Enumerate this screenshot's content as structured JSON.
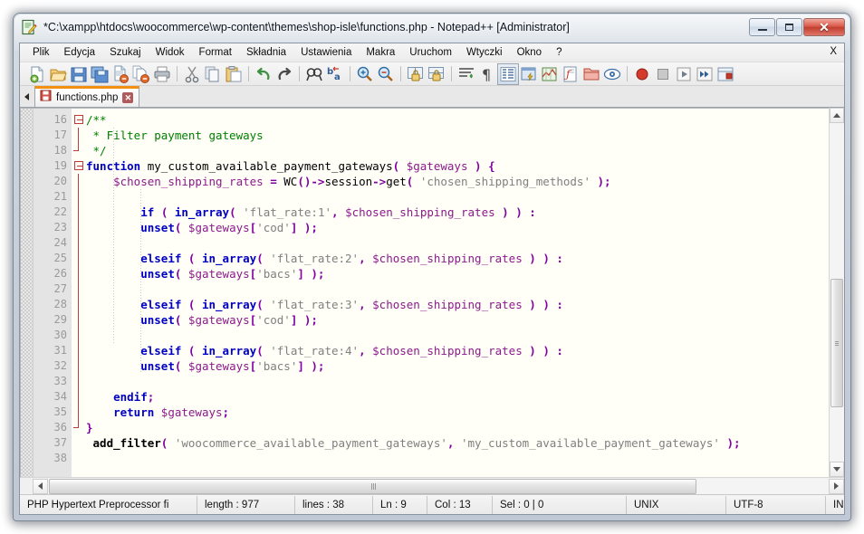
{
  "window": {
    "title": "*C:\\xampp\\htdocs\\woocommerce\\wp-content\\themes\\shop-isle\\functions.php - Notepad++ [Administrator]",
    "minimize_label": "",
    "maximize_label": "",
    "close_label": "✕"
  },
  "menu": {
    "items": [
      {
        "label": "Plik"
      },
      {
        "label": "Edycja"
      },
      {
        "label": "Szukaj"
      },
      {
        "label": "Widok"
      },
      {
        "label": "Format"
      },
      {
        "label": "Składnia"
      },
      {
        "label": "Ustawienia"
      },
      {
        "label": "Makra"
      },
      {
        "label": "Uruchom"
      },
      {
        "label": "Wtyczki"
      },
      {
        "label": "Okno"
      },
      {
        "label": "?"
      }
    ],
    "right_label": "X"
  },
  "toolbar": {
    "icons": [
      "new-file-icon",
      "open-file-icon",
      "save-icon",
      "save-all-icon",
      "close-file-icon",
      "close-all-icon",
      "print-icon",
      "cut-icon",
      "copy-icon",
      "paste-icon",
      "undo-icon",
      "redo-icon",
      "find-icon",
      "replace-icon",
      "zoom-in-icon",
      "zoom-out-icon",
      "sync-vertical-icon",
      "sync-horizontal-icon",
      "word-wrap-icon",
      "show-all-chars-icon",
      "indent-guide-icon",
      "user-defined-dialog-icon",
      "show-doc-map-icon",
      "function-list-icon",
      "folder-as-workspace-icon",
      "monitoring-icon",
      "record-macro-icon",
      "stop-macro-icon",
      "play-macro-icon",
      "run-macro-multiple-icon",
      "save-macro-icon"
    ]
  },
  "tabs": {
    "scroll_left_icon": "chevron-left-icon",
    "items": [
      {
        "label": "functions.php",
        "icon": "save-red-icon",
        "close_label": "✕",
        "active": true
      }
    ]
  },
  "editor": {
    "first_line": 16,
    "lines": [
      {
        "n": 16,
        "fold": "open",
        "tokens": [
          {
            "t": "/**",
            "c": "cmt"
          }
        ]
      },
      {
        "n": 17,
        "fold": "bar",
        "tokens": [
          {
            "t": " * Filter payment gateways",
            "c": "cmt"
          }
        ]
      },
      {
        "n": 18,
        "fold": "end",
        "tokens": [
          {
            "t": " */",
            "c": "cmt"
          }
        ]
      },
      {
        "n": 19,
        "fold": "open",
        "tokens": [
          {
            "t": "function",
            "c": "kw"
          },
          {
            "t": " my_custom_available_payment_gateways",
            "c": "pl"
          },
          {
            "t": "(",
            "c": "op"
          },
          {
            "t": " ",
            "c": "pl"
          },
          {
            "t": "$gateways",
            "c": "var"
          },
          {
            "t": " ",
            "c": "pl"
          },
          {
            "t": ")",
            "c": "op"
          },
          {
            "t": " ",
            "c": "pl"
          },
          {
            "t": "{",
            "c": "op"
          }
        ]
      },
      {
        "n": 20,
        "fold": "bar",
        "tokens": [
          {
            "t": "    ",
            "c": "pl"
          },
          {
            "t": "$chosen_shipping_rates",
            "c": "var"
          },
          {
            "t": " ",
            "c": "pl"
          },
          {
            "t": "=",
            "c": "op"
          },
          {
            "t": " WC",
            "c": "pl"
          },
          {
            "t": "()",
            "c": "op"
          },
          {
            "t": "-",
            "c": "op"
          },
          {
            "t": ">",
            "c": "op"
          },
          {
            "t": "session",
            "c": "pl"
          },
          {
            "t": "-",
            "c": "op"
          },
          {
            "t": ">",
            "c": "op"
          },
          {
            "t": "get",
            "c": "pl"
          },
          {
            "t": "(",
            "c": "op"
          },
          {
            "t": " ",
            "c": "pl"
          },
          {
            "t": "'chosen_shipping_methods'",
            "c": "str"
          },
          {
            "t": " ",
            "c": "pl"
          },
          {
            "t": ");",
            "c": "op"
          }
        ]
      },
      {
        "n": 21,
        "fold": "bar",
        "tokens": []
      },
      {
        "n": 22,
        "fold": "bar",
        "tokens": [
          {
            "t": "        ",
            "c": "pl"
          },
          {
            "t": "if",
            "c": "kw"
          },
          {
            "t": " ",
            "c": "pl"
          },
          {
            "t": "(",
            "c": "op"
          },
          {
            "t": " ",
            "c": "pl"
          },
          {
            "t": "in_array",
            "c": "kw"
          },
          {
            "t": "(",
            "c": "op"
          },
          {
            "t": " ",
            "c": "pl"
          },
          {
            "t": "'flat_rate:1'",
            "c": "str"
          },
          {
            "t": ",",
            "c": "op"
          },
          {
            "t": " ",
            "c": "pl"
          },
          {
            "t": "$chosen_shipping_rates",
            "c": "var"
          },
          {
            "t": " ",
            "c": "pl"
          },
          {
            "t": ") )",
            "c": "op"
          },
          {
            "t": " ",
            "c": "pl"
          },
          {
            "t": ":",
            "c": "op"
          }
        ]
      },
      {
        "n": 23,
        "fold": "bar",
        "tokens": [
          {
            "t": "        ",
            "c": "pl"
          },
          {
            "t": "unset",
            "c": "kw"
          },
          {
            "t": "(",
            "c": "op"
          },
          {
            "t": " ",
            "c": "pl"
          },
          {
            "t": "$gateways",
            "c": "var"
          },
          {
            "t": "[",
            "c": "op"
          },
          {
            "t": "'cod'",
            "c": "str"
          },
          {
            "t": "]",
            "c": "op"
          },
          {
            "t": " ",
            "c": "pl"
          },
          {
            "t": ");",
            "c": "op"
          }
        ]
      },
      {
        "n": 24,
        "fold": "bar",
        "tokens": []
      },
      {
        "n": 25,
        "fold": "bar",
        "tokens": [
          {
            "t": "        ",
            "c": "pl"
          },
          {
            "t": "elseif",
            "c": "kw"
          },
          {
            "t": " ",
            "c": "pl"
          },
          {
            "t": "(",
            "c": "op"
          },
          {
            "t": " ",
            "c": "pl"
          },
          {
            "t": "in_array",
            "c": "kw"
          },
          {
            "t": "(",
            "c": "op"
          },
          {
            "t": " ",
            "c": "pl"
          },
          {
            "t": "'flat_rate:2'",
            "c": "str"
          },
          {
            "t": ",",
            "c": "op"
          },
          {
            "t": " ",
            "c": "pl"
          },
          {
            "t": "$chosen_shipping_rates",
            "c": "var"
          },
          {
            "t": " ",
            "c": "pl"
          },
          {
            "t": ") )",
            "c": "op"
          },
          {
            "t": " ",
            "c": "pl"
          },
          {
            "t": ":",
            "c": "op"
          }
        ]
      },
      {
        "n": 26,
        "fold": "bar",
        "tokens": [
          {
            "t": "        ",
            "c": "pl"
          },
          {
            "t": "unset",
            "c": "kw"
          },
          {
            "t": "(",
            "c": "op"
          },
          {
            "t": " ",
            "c": "pl"
          },
          {
            "t": "$gateways",
            "c": "var"
          },
          {
            "t": "[",
            "c": "op"
          },
          {
            "t": "'bacs'",
            "c": "str"
          },
          {
            "t": "]",
            "c": "op"
          },
          {
            "t": " ",
            "c": "pl"
          },
          {
            "t": ");",
            "c": "op"
          }
        ]
      },
      {
        "n": 27,
        "fold": "bar",
        "tokens": []
      },
      {
        "n": 28,
        "fold": "bar",
        "tokens": [
          {
            "t": "        ",
            "c": "pl"
          },
          {
            "t": "elseif",
            "c": "kw"
          },
          {
            "t": " ",
            "c": "pl"
          },
          {
            "t": "(",
            "c": "op"
          },
          {
            "t": " ",
            "c": "pl"
          },
          {
            "t": "in_array",
            "c": "kw"
          },
          {
            "t": "(",
            "c": "op"
          },
          {
            "t": " ",
            "c": "pl"
          },
          {
            "t": "'flat_rate:3'",
            "c": "str"
          },
          {
            "t": ",",
            "c": "op"
          },
          {
            "t": " ",
            "c": "pl"
          },
          {
            "t": "$chosen_shipping_rates",
            "c": "var"
          },
          {
            "t": " ",
            "c": "pl"
          },
          {
            "t": ") )",
            "c": "op"
          },
          {
            "t": " ",
            "c": "pl"
          },
          {
            "t": ":",
            "c": "op"
          }
        ]
      },
      {
        "n": 29,
        "fold": "bar",
        "tokens": [
          {
            "t": "        ",
            "c": "pl"
          },
          {
            "t": "unset",
            "c": "kw"
          },
          {
            "t": "(",
            "c": "op"
          },
          {
            "t": " ",
            "c": "pl"
          },
          {
            "t": "$gateways",
            "c": "var"
          },
          {
            "t": "[",
            "c": "op"
          },
          {
            "t": "'cod'",
            "c": "str"
          },
          {
            "t": "]",
            "c": "op"
          },
          {
            "t": " ",
            "c": "pl"
          },
          {
            "t": ");",
            "c": "op"
          }
        ]
      },
      {
        "n": 30,
        "fold": "bar",
        "tokens": []
      },
      {
        "n": 31,
        "fold": "bar",
        "tokens": [
          {
            "t": "        ",
            "c": "pl"
          },
          {
            "t": "elseif",
            "c": "kw"
          },
          {
            "t": " ",
            "c": "pl"
          },
          {
            "t": "(",
            "c": "op"
          },
          {
            "t": " ",
            "c": "pl"
          },
          {
            "t": "in_array",
            "c": "kw"
          },
          {
            "t": "(",
            "c": "op"
          },
          {
            "t": " ",
            "c": "pl"
          },
          {
            "t": "'flat_rate:4'",
            "c": "str"
          },
          {
            "t": ",",
            "c": "op"
          },
          {
            "t": " ",
            "c": "pl"
          },
          {
            "t": "$chosen_shipping_rates",
            "c": "var"
          },
          {
            "t": " ",
            "c": "pl"
          },
          {
            "t": ") )",
            "c": "op"
          },
          {
            "t": " ",
            "c": "pl"
          },
          {
            "t": ":",
            "c": "op"
          }
        ]
      },
      {
        "n": 32,
        "fold": "bar",
        "tokens": [
          {
            "t": "        ",
            "c": "pl"
          },
          {
            "t": "unset",
            "c": "kw"
          },
          {
            "t": "(",
            "c": "op"
          },
          {
            "t": " ",
            "c": "pl"
          },
          {
            "t": "$gateways",
            "c": "var"
          },
          {
            "t": "[",
            "c": "op"
          },
          {
            "t": "'bacs'",
            "c": "str"
          },
          {
            "t": "]",
            "c": "op"
          },
          {
            "t": " ",
            "c": "pl"
          },
          {
            "t": ");",
            "c": "op"
          }
        ]
      },
      {
        "n": 33,
        "fold": "bar",
        "tokens": []
      },
      {
        "n": 34,
        "fold": "bar",
        "tokens": [
          {
            "t": "    ",
            "c": "pl"
          },
          {
            "t": "endif",
            "c": "kw"
          },
          {
            "t": ";",
            "c": "op"
          }
        ]
      },
      {
        "n": 35,
        "fold": "bar",
        "tokens": [
          {
            "t": "    ",
            "c": "pl"
          },
          {
            "t": "return",
            "c": "kw"
          },
          {
            "t": " ",
            "c": "pl"
          },
          {
            "t": "$gateways",
            "c": "var"
          },
          {
            "t": ";",
            "c": "op"
          }
        ]
      },
      {
        "n": 36,
        "fold": "end",
        "tokens": [
          {
            "t": "}",
            "c": "op"
          }
        ]
      },
      {
        "n": 37,
        "fold": "none",
        "tokens": [
          {
            "t": " ",
            "c": "pl"
          },
          {
            "t": "add_filter",
            "c": "blk"
          },
          {
            "t": "(",
            "c": "op"
          },
          {
            "t": " ",
            "c": "pl"
          },
          {
            "t": "'woocommerce_available_payment_gateways'",
            "c": "str"
          },
          {
            "t": ",",
            "c": "op"
          },
          {
            "t": " ",
            "c": "pl"
          },
          {
            "t": "'my_custom_available_payment_gateways'",
            "c": "str"
          },
          {
            "t": " ",
            "c": "pl"
          },
          {
            "t": ");",
            "c": "op"
          }
        ]
      },
      {
        "n": 38,
        "fold": "none",
        "tokens": []
      }
    ]
  },
  "statusbar": {
    "file_type": "PHP Hypertext Preprocessor fi",
    "length": "length : 977",
    "lines": "lines : 38",
    "ln": "Ln : 9",
    "col": "Col : 13",
    "sel": "Sel : 0 | 0",
    "eol": "UNIX",
    "encoding": "UTF-8",
    "mode": "INS"
  },
  "colors": {
    "tab_accent": "#f29111",
    "keyword": "#0000c0",
    "variable": "#8b1a8b",
    "string": "#808080",
    "comment": "#008000",
    "operator": "#8000a0",
    "editor_bg": "#fffef7",
    "fold_marker": "#c03a3a"
  }
}
